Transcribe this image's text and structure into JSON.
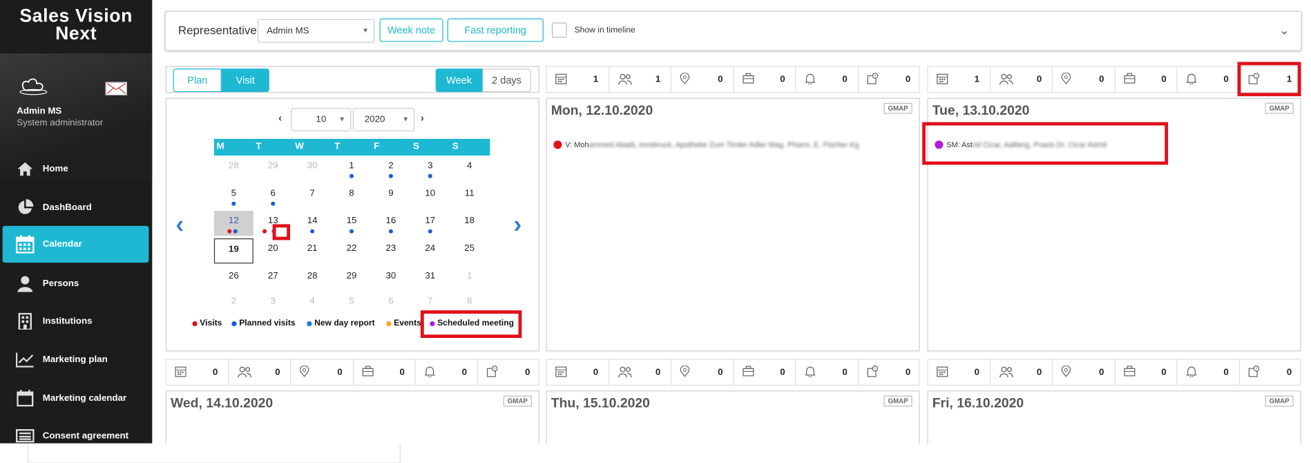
{
  "app": {
    "brand_line1": "Sales Vision",
    "brand_line2": "Next"
  },
  "user": {
    "name": "Admin MS",
    "role": "System administrator"
  },
  "nav": [
    {
      "label": "Home",
      "icon": "home-icon"
    },
    {
      "label": "DashBoard",
      "icon": "pie-chart-icon"
    },
    {
      "label": "Calendar",
      "icon": "calendar-icon",
      "active": true
    },
    {
      "label": "Persons",
      "icon": "persons-icon"
    },
    {
      "label": "Institutions",
      "icon": "building-icon"
    },
    {
      "label": "Marketing plan",
      "icon": "trend-chart-icon"
    },
    {
      "label": "Marketing calendar",
      "icon": "calendar-icon"
    },
    {
      "label": "Consent agreement",
      "icon": "keyboard-icon"
    }
  ],
  "toolbar": {
    "rep_label": "Representative",
    "rep_value": "Admin MS",
    "week_note": "Week note",
    "fast_reporting": "Fast reporting",
    "show_timeline": "Show in timeline"
  },
  "mini_cal": {
    "modes": [
      "Plan",
      "Visit"
    ],
    "ranges": [
      "Week",
      "2 days"
    ],
    "month": "10",
    "year": "2020",
    "weekdays": [
      "M",
      "T",
      "W",
      "T",
      "F",
      "S",
      "S"
    ],
    "weeks": [
      [
        "28",
        "29",
        "30",
        "1",
        "2",
        "3",
        "4"
      ],
      [
        "5",
        "6",
        "7",
        "8",
        "9",
        "10",
        "11"
      ],
      [
        "12",
        "13",
        "14",
        "15",
        "16",
        "17",
        "18"
      ],
      [
        "19",
        "20",
        "21",
        "22",
        "23",
        "24",
        "25"
      ],
      [
        "26",
        "27",
        "28",
        "29",
        "30",
        "31",
        "1"
      ],
      [
        "2",
        "3",
        "4",
        "5",
        "6",
        "7",
        "8"
      ]
    ],
    "legend": [
      "Visits",
      "Planned visits",
      "New day report",
      "Events",
      "Scheduled meeting"
    ]
  },
  "colors": {
    "accent": "#1eb8d3",
    "visit": "#e0101a",
    "planned": "#1a5fd6",
    "new_day": "#1a7ae0",
    "event": "#f5a623",
    "meeting": "#b21ae0",
    "highlight": "#e0101a"
  },
  "days": [
    {
      "title": "Mon, 12.10.2020",
      "gmap": "GMAP",
      "stats": [
        "1",
        "1",
        "0",
        "0",
        "0",
        "0"
      ],
      "event_prefix": "V: Moh",
      "event_rest": "ammed Abadi, Innsbruck, Apotheke Zum Tiroler Adler Mag. Pharm. E. Fischer Kg",
      "event_color": "#e0101a"
    },
    {
      "title": "Tue, 13.10.2020",
      "gmap": "GMAP",
      "stats": [
        "1",
        "0",
        "0",
        "0",
        "0",
        "1"
      ],
      "event_prefix": "SM: Ast",
      "event_rest": "rid Cicar, Aalfang, Praxis Dr. Cicar Astrid",
      "event_color": "#b21ae0"
    },
    {
      "title": "Wed, 14.10.2020",
      "gmap": "GMAP",
      "stats": [
        "0",
        "0",
        "0",
        "0",
        "0",
        "0"
      ]
    },
    {
      "title": "Thu, 15.10.2020",
      "gmap": "GMAP",
      "stats": [
        "0",
        "0",
        "0",
        "0",
        "0",
        "0"
      ]
    },
    {
      "title": "Fri, 16.10.2020",
      "gmap": "GMAP",
      "stats": [
        "0",
        "0",
        "0",
        "0",
        "0",
        "0"
      ]
    }
  ],
  "stat_icons": [
    "calendar-icon",
    "people-icon",
    "location-pin-icon",
    "briefcase-icon",
    "bell-icon",
    "meeting-calendar-icon"
  ]
}
